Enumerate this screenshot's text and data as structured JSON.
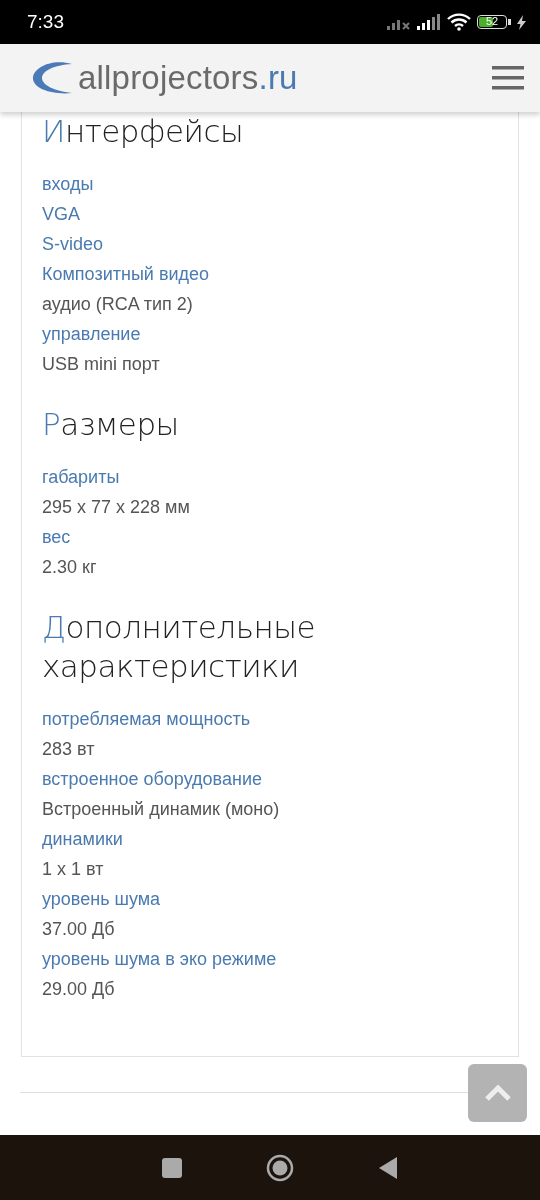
{
  "status_bar": {
    "time": "7:33",
    "battery": "52"
  },
  "header": {
    "logo_main": "allprojectors",
    "logo_suffix": ".ru"
  },
  "sections": [
    {
      "title": "Интерфейсы",
      "rows": [
        {
          "kind": "label",
          "text": "входы"
        },
        {
          "kind": "label",
          "text": "VGA"
        },
        {
          "kind": "label",
          "text": "S-video"
        },
        {
          "kind": "label",
          "text": "Композитный видео"
        },
        {
          "kind": "value",
          "text": "аудио (RCA тип 2)"
        },
        {
          "kind": "label",
          "text": "управление"
        },
        {
          "kind": "value",
          "text": "USB mini порт"
        }
      ]
    },
    {
      "title": "Размеры",
      "rows": [
        {
          "kind": "label",
          "text": "габариты"
        },
        {
          "kind": "value",
          "text": "295 x 77 x 228 мм"
        },
        {
          "kind": "label",
          "text": "вес"
        },
        {
          "kind": "value",
          "text": "2.30 кг"
        }
      ]
    },
    {
      "title": "Дополнительные характеристики",
      "rows": [
        {
          "kind": "label",
          "text": "потребляемая мощность"
        },
        {
          "kind": "value",
          "text": "283 вт"
        },
        {
          "kind": "label",
          "text": "встроенное оборудование"
        },
        {
          "kind": "value",
          "text": "Встроенный динамик (моно)"
        },
        {
          "kind": "label",
          "text": "динамики"
        },
        {
          "kind": "value",
          "text": "1 x 1 вт"
        },
        {
          "kind": "label",
          "text": "уровень шума"
        },
        {
          "kind": "value",
          "text": "37.00 Дб"
        },
        {
          "kind": "label",
          "text": "уровень шума в эко режиме"
        },
        {
          "kind": "value",
          "text": "29.00 Дб"
        }
      ]
    }
  ]
}
